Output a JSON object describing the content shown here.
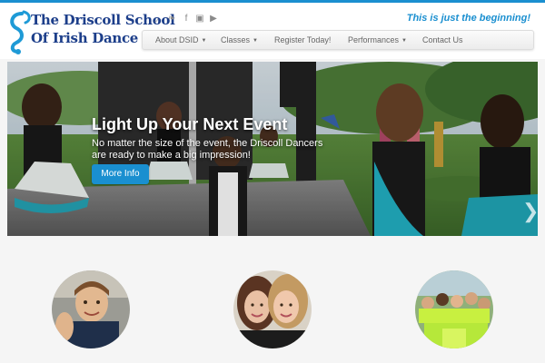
{
  "brand": {
    "logo_line1": "The Driscoll School",
    "logo_line2": "Of Irish Dance",
    "tagline": "This is just the beginning!",
    "accent_color": "#1a8fd0",
    "logo_color": "#1c3e8a"
  },
  "social": [
    {
      "icon": "rss-icon",
      "glyph": "◞"
    },
    {
      "icon": "twitter-icon",
      "glyph": "❧"
    },
    {
      "icon": "facebook-icon",
      "glyph": "f"
    },
    {
      "icon": "instagram-icon",
      "glyph": "▣"
    },
    {
      "icon": "youtube-icon",
      "glyph": "▶"
    }
  ],
  "nav": [
    {
      "label": "About DSID",
      "dropdown": true
    },
    {
      "label": "Classes",
      "dropdown": true
    },
    {
      "label": "Register Today!",
      "dropdown": false
    },
    {
      "label": "Performances",
      "dropdown": true
    },
    {
      "label": "Contact Us",
      "dropdown": false
    }
  ],
  "hero": {
    "title": "Light Up Your Next Event",
    "subtitle": "No matter the size of the event, the Driscoll Dancers are ready to make a big impression!",
    "button_label": "More Info",
    "next_glyph": "❯"
  },
  "features": [
    {
      "name": "feature-photo-boy"
    },
    {
      "name": "feature-photo-two-women"
    },
    {
      "name": "feature-photo-group"
    }
  ]
}
